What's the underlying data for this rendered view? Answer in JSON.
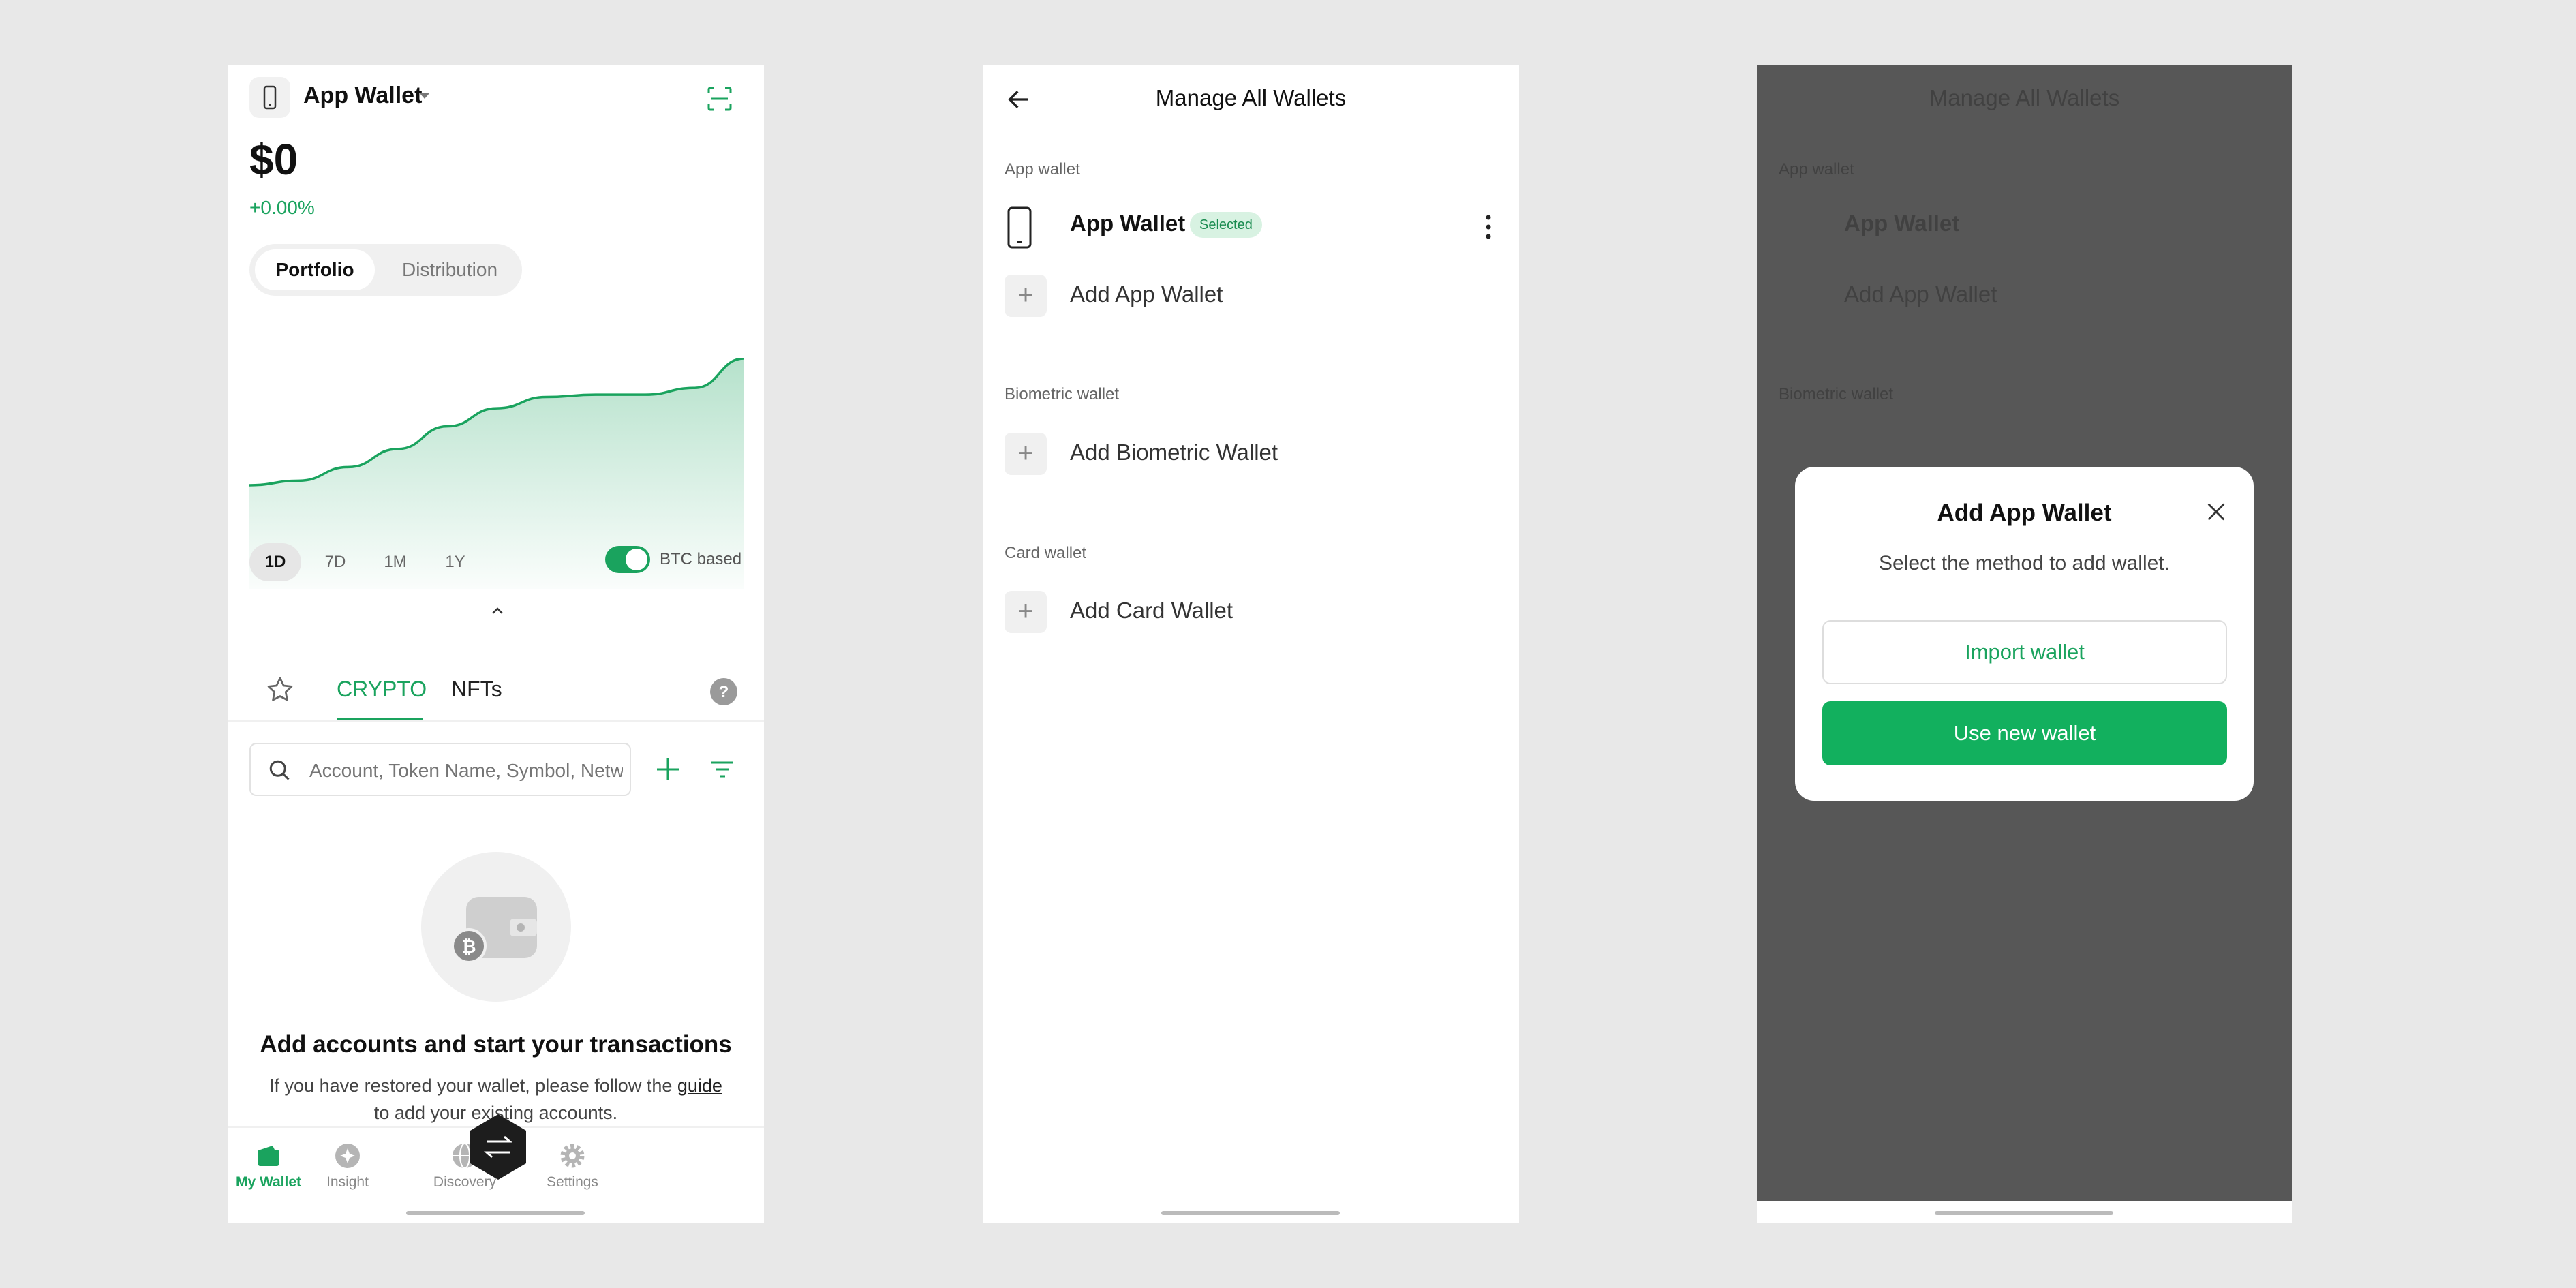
{
  "screen1": {
    "wallet_name": "App Wallet",
    "balance": "$0",
    "change": "+0.00%",
    "segment": [
      "Portfolio",
      "Distribution"
    ],
    "chart_data": {
      "type": "area",
      "x": [
        0,
        1,
        2,
        3,
        4,
        5,
        6,
        7,
        8,
        9,
        10
      ],
      "values": [
        22,
        24,
        30,
        38,
        48,
        56,
        61,
        62,
        62,
        65,
        78
      ]
    },
    "ranges": [
      "1D",
      "7D",
      "1M",
      "1Y"
    ],
    "toggle_label": "BTC based",
    "btc_toggle_on": true,
    "tabs": [
      "CRYPTO",
      "NFTs"
    ],
    "search_placeholder": "Account, Token Name, Symbol, Network",
    "empty_title": "Add accounts and start your transactions",
    "empty_desc_pre": "If you have restored your wallet, please follow the",
    "empty_desc_link": "guide",
    "empty_desc_post": "to add your existing accounts.",
    "nav": [
      "My Wallet",
      "Insight",
      "Discovery",
      "Settings"
    ],
    "accent": "#1aa35e"
  },
  "screen2": {
    "title": "Manage All Wallets",
    "sections": {
      "app": "App wallet",
      "biometric": "Biometric wallet",
      "card": "Card wallet"
    },
    "app_wallet_name": "App Wallet",
    "selected_badge": "Selected",
    "add_app": "Add App Wallet",
    "add_biometric": "Add Biometric Wallet",
    "add_card": "Add Card Wallet"
  },
  "screen3": {
    "modal_title": "Add App Wallet",
    "modal_subtitle": "Select the method to add wallet.",
    "import_label": "Import wallet",
    "new_label": "Use new wallet"
  }
}
